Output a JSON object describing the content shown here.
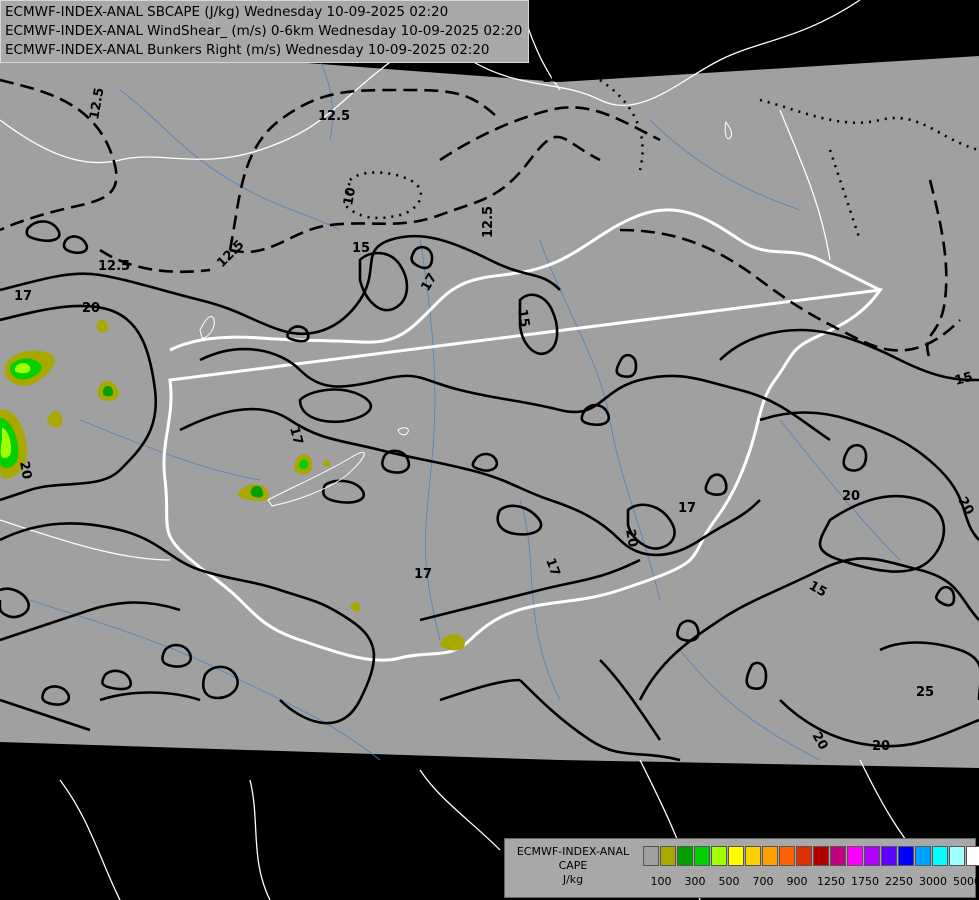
{
  "header": {
    "line1": "ECMWF-INDEX-ANAL SBCAPE (J/kg) Wednesday 10-09-2025 02:20",
    "line2": "ECMWF-INDEX-ANAL WindShear_ (m/s) 0-6km Wednesday 10-09-2025 02:20",
    "line3": "ECMWF-INDEX-ANAL Bunkers Right (m/s) Wednesday 10-09-2025 02:20"
  },
  "legend": {
    "title1": "ECMWF-INDEX-ANAL",
    "title2": "CAPE",
    "title3": "J/kg",
    "colors": [
      "#a0a0a0",
      "#a8a800",
      "#00a000",
      "#00d000",
      "#a0ff00",
      "#ffff00",
      "#ffd000",
      "#ffa000",
      "#ff6000",
      "#e03000",
      "#b00000",
      "#c00080",
      "#ff00ff",
      "#b000ff",
      "#6000ff",
      "#0000ff",
      "#00a0ff",
      "#00ffff",
      "#a0ffff",
      "#ffffff"
    ],
    "ticks": [
      "100",
      "300",
      "500",
      "700",
      "900",
      "1250",
      "1750",
      "2250",
      "3000",
      "5000"
    ]
  },
  "contour_labels": {
    "l125": "12.5",
    "l10": "10",
    "l15": "15",
    "l17": "17",
    "l20": "20",
    "l25": "25"
  }
}
